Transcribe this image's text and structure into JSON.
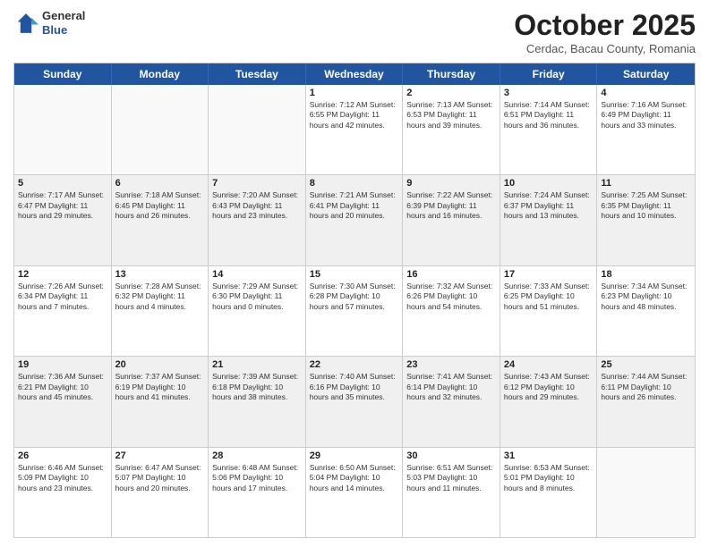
{
  "header": {
    "logo": {
      "general": "General",
      "blue": "Blue"
    },
    "title": "October 2025",
    "subtitle": "Cerdac, Bacau County, Romania"
  },
  "days_of_week": [
    "Sunday",
    "Monday",
    "Tuesday",
    "Wednesday",
    "Thursday",
    "Friday",
    "Saturday"
  ],
  "rows": [
    {
      "cells": [
        {
          "day": "",
          "empty": true
        },
        {
          "day": "",
          "empty": true
        },
        {
          "day": "",
          "empty": true
        },
        {
          "day": "1",
          "info": "Sunrise: 7:12 AM\nSunset: 6:55 PM\nDaylight: 11 hours\nand 42 minutes."
        },
        {
          "day": "2",
          "info": "Sunrise: 7:13 AM\nSunset: 6:53 PM\nDaylight: 11 hours\nand 39 minutes."
        },
        {
          "day": "3",
          "info": "Sunrise: 7:14 AM\nSunset: 6:51 PM\nDaylight: 11 hours\nand 36 minutes."
        },
        {
          "day": "4",
          "info": "Sunrise: 7:16 AM\nSunset: 6:49 PM\nDaylight: 11 hours\nand 33 minutes."
        }
      ]
    },
    {
      "cells": [
        {
          "day": "5",
          "info": "Sunrise: 7:17 AM\nSunset: 6:47 PM\nDaylight: 11 hours\nand 29 minutes."
        },
        {
          "day": "6",
          "info": "Sunrise: 7:18 AM\nSunset: 6:45 PM\nDaylight: 11 hours\nand 26 minutes."
        },
        {
          "day": "7",
          "info": "Sunrise: 7:20 AM\nSunset: 6:43 PM\nDaylight: 11 hours\nand 23 minutes."
        },
        {
          "day": "8",
          "info": "Sunrise: 7:21 AM\nSunset: 6:41 PM\nDaylight: 11 hours\nand 20 minutes."
        },
        {
          "day": "9",
          "info": "Sunrise: 7:22 AM\nSunset: 6:39 PM\nDaylight: 11 hours\nand 16 minutes."
        },
        {
          "day": "10",
          "info": "Sunrise: 7:24 AM\nSunset: 6:37 PM\nDaylight: 11 hours\nand 13 minutes."
        },
        {
          "day": "11",
          "info": "Sunrise: 7:25 AM\nSunset: 6:35 PM\nDaylight: 11 hours\nand 10 minutes."
        }
      ]
    },
    {
      "cells": [
        {
          "day": "12",
          "info": "Sunrise: 7:26 AM\nSunset: 6:34 PM\nDaylight: 11 hours\nand 7 minutes."
        },
        {
          "day": "13",
          "info": "Sunrise: 7:28 AM\nSunset: 6:32 PM\nDaylight: 11 hours\nand 4 minutes."
        },
        {
          "day": "14",
          "info": "Sunrise: 7:29 AM\nSunset: 6:30 PM\nDaylight: 11 hours\nand 0 minutes."
        },
        {
          "day": "15",
          "info": "Sunrise: 7:30 AM\nSunset: 6:28 PM\nDaylight: 10 hours\nand 57 minutes."
        },
        {
          "day": "16",
          "info": "Sunrise: 7:32 AM\nSunset: 6:26 PM\nDaylight: 10 hours\nand 54 minutes."
        },
        {
          "day": "17",
          "info": "Sunrise: 7:33 AM\nSunset: 6:25 PM\nDaylight: 10 hours\nand 51 minutes."
        },
        {
          "day": "18",
          "info": "Sunrise: 7:34 AM\nSunset: 6:23 PM\nDaylight: 10 hours\nand 48 minutes."
        }
      ]
    },
    {
      "cells": [
        {
          "day": "19",
          "info": "Sunrise: 7:36 AM\nSunset: 6:21 PM\nDaylight: 10 hours\nand 45 minutes."
        },
        {
          "day": "20",
          "info": "Sunrise: 7:37 AM\nSunset: 6:19 PM\nDaylight: 10 hours\nand 41 minutes."
        },
        {
          "day": "21",
          "info": "Sunrise: 7:39 AM\nSunset: 6:18 PM\nDaylight: 10 hours\nand 38 minutes."
        },
        {
          "day": "22",
          "info": "Sunrise: 7:40 AM\nSunset: 6:16 PM\nDaylight: 10 hours\nand 35 minutes."
        },
        {
          "day": "23",
          "info": "Sunrise: 7:41 AM\nSunset: 6:14 PM\nDaylight: 10 hours\nand 32 minutes."
        },
        {
          "day": "24",
          "info": "Sunrise: 7:43 AM\nSunset: 6:12 PM\nDaylight: 10 hours\nand 29 minutes."
        },
        {
          "day": "25",
          "info": "Sunrise: 7:44 AM\nSunset: 6:11 PM\nDaylight: 10 hours\nand 26 minutes."
        }
      ]
    },
    {
      "cells": [
        {
          "day": "26",
          "info": "Sunrise: 6:46 AM\nSunset: 5:09 PM\nDaylight: 10 hours\nand 23 minutes."
        },
        {
          "day": "27",
          "info": "Sunrise: 6:47 AM\nSunset: 5:07 PM\nDaylight: 10 hours\nand 20 minutes."
        },
        {
          "day": "28",
          "info": "Sunrise: 6:48 AM\nSunset: 5:06 PM\nDaylight: 10 hours\nand 17 minutes."
        },
        {
          "day": "29",
          "info": "Sunrise: 6:50 AM\nSunset: 5:04 PM\nDaylight: 10 hours\nand 14 minutes."
        },
        {
          "day": "30",
          "info": "Sunrise: 6:51 AM\nSunset: 5:03 PM\nDaylight: 10 hours\nand 11 minutes."
        },
        {
          "day": "31",
          "info": "Sunrise: 6:53 AM\nSunset: 5:01 PM\nDaylight: 10 hours\nand 8 minutes."
        },
        {
          "day": "",
          "empty": true
        }
      ]
    }
  ]
}
